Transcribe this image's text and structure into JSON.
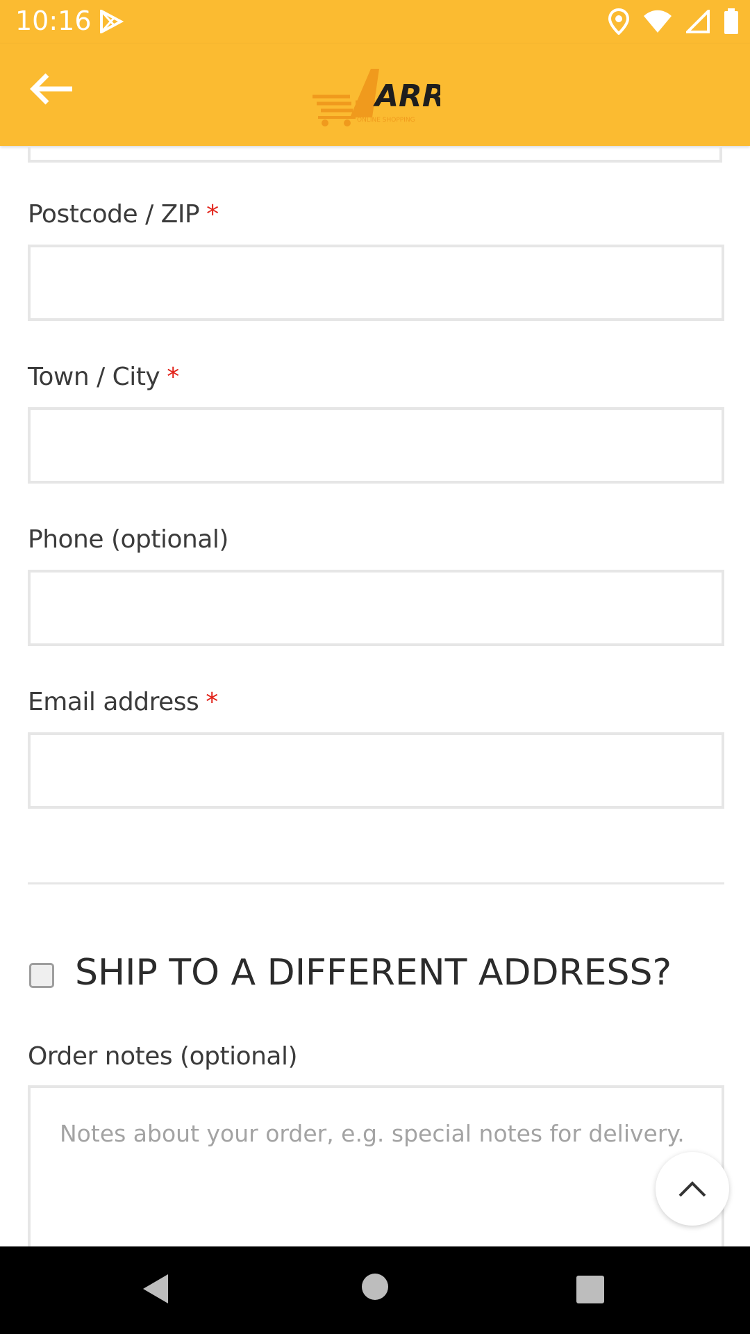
{
  "status_bar": {
    "time": "10:16",
    "icons": [
      "play-store-icon",
      "location-icon",
      "wifi-icon",
      "signal-icon",
      "battery-icon"
    ]
  },
  "app_bar": {
    "back_icon": "arrow-left-icon",
    "logo": {
      "text": "ARRAM",
      "subtitle": "ONLINE SHOPPING"
    }
  },
  "form": {
    "fields": [
      {
        "label": "Postcode / ZIP",
        "required": true,
        "value": ""
      },
      {
        "label": "Town / City",
        "required": true,
        "value": ""
      },
      {
        "label": "Phone (optional)",
        "required": false,
        "value": ""
      },
      {
        "label": "Email address",
        "required": true,
        "value": ""
      }
    ],
    "required_mark": "*",
    "ship_different": {
      "label": "SHIP TO A DIFFERENT ADDRESS?",
      "checked": false
    },
    "order_notes": {
      "label": "Order notes (optional)",
      "placeholder": "Notes about your order, e.g. special notes for delivery."
    }
  },
  "colors": {
    "accent": "#fbbb31",
    "required": "#e2231a"
  },
  "nav_bar": {
    "icons": [
      "back-triangle-icon",
      "home-circle-icon",
      "recents-square-icon"
    ]
  }
}
